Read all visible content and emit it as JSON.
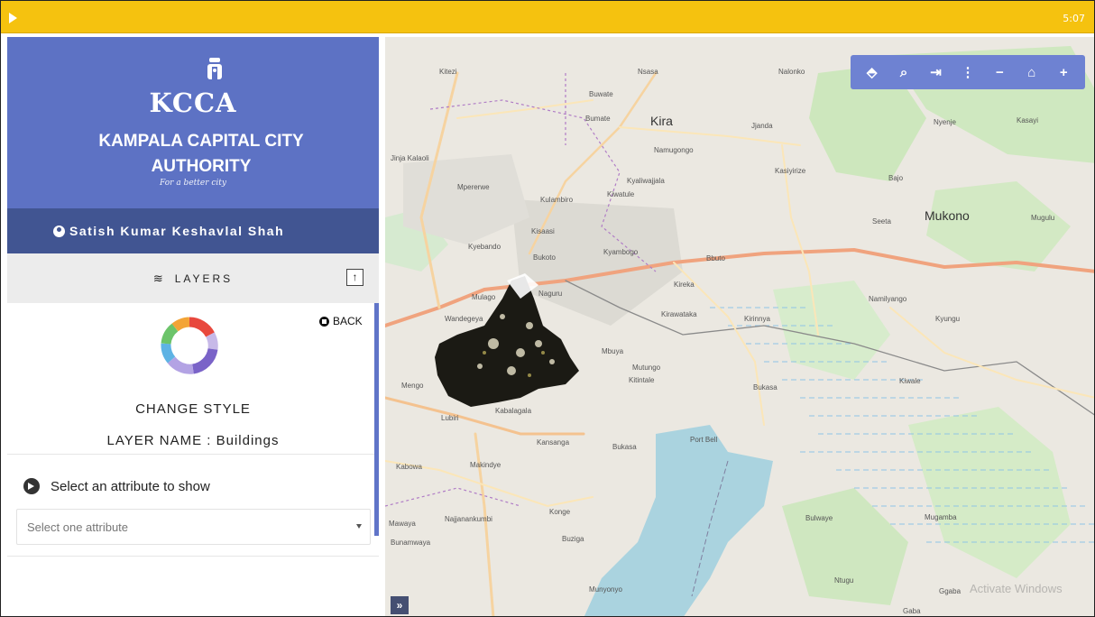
{
  "status_bar": {
    "time": "5:07"
  },
  "brand": {
    "short": "KCCA",
    "full_name": "KAMPALA CAPITAL CITY AUTHORITY",
    "tagline": "For a better city"
  },
  "user": {
    "name": "Satish Kumar Keshavlal Shah"
  },
  "layers": {
    "title": "LAYERS",
    "up_label": "↑"
  },
  "style_panel": {
    "back_label": "BACK",
    "change_style": "CHANGE STYLE",
    "layer_name": "LAYER NAME : Buildings"
  },
  "attribute": {
    "heading": "Select an attribute to show",
    "placeholder": "Select one attribute"
  },
  "map": {
    "toolbar": [
      {
        "name": "eraser-icon",
        "glyph": "⬘"
      },
      {
        "name": "zoom-search-icon",
        "glyph": "⌕"
      },
      {
        "name": "sign-in-icon",
        "glyph": "⇥"
      },
      {
        "name": "more-vertical-icon",
        "glyph": "⋮"
      },
      {
        "name": "zoom-out-icon",
        "glyph": "−"
      },
      {
        "name": "home-icon",
        "glyph": "⌂"
      },
      {
        "name": "zoom-in-icon",
        "glyph": "+"
      }
    ],
    "expand_glyph": "»",
    "watermark": "Activate Windows",
    "places": [
      "Kitezi",
      "Nsasa",
      "Nalonko",
      "Buwate",
      "Bumate",
      "Kira",
      "Jjanda",
      "Nyenje",
      "Kasayi",
      "Jinja Kalaoli",
      "Namugongo",
      "Kyaliwajjala",
      "Kasiyirize",
      "Bajo",
      "Mpererwe",
      "Kiwatule",
      "Kulambiro",
      "Kisaasi",
      "Kyebando",
      "Bukoto",
      "Kyambogo",
      "Bbuto",
      "Seeta",
      "Mukono",
      "Mugulu",
      "Kireka",
      "Mulago",
      "Naguru",
      "Namilyango",
      "Kyungu",
      "Wandegeya",
      "Kirawataka",
      "Kirinnya",
      "Mbuya",
      "Mutungo",
      "Kitintale",
      "Bukasa",
      "Mengo",
      "Lubiri",
      "Kabalagala",
      "Kiwale",
      "Kansanga",
      "Bukasa",
      "Port Bell",
      "Kabowa",
      "Makindye",
      "Konge",
      "Najjanankumbi",
      "Buziga",
      "Ggaba",
      "Bulwaye",
      "Mugamba",
      "Munyonyo",
      "Ntugu",
      "Gaba",
      "Mawaya",
      "Bunamwaya"
    ]
  }
}
